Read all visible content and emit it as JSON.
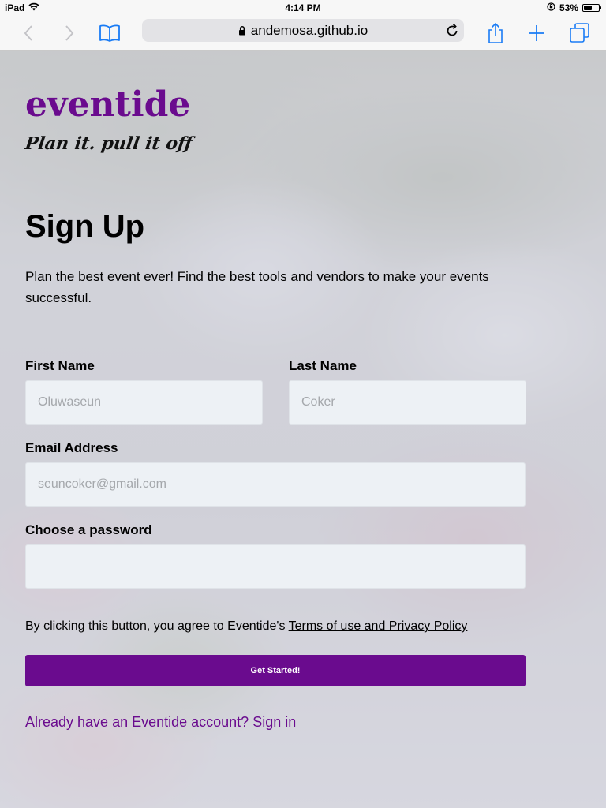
{
  "status_bar": {
    "device": "iPad",
    "time": "4:14 PM",
    "battery_percent": "53%",
    "battery_level": 0.53
  },
  "browser": {
    "url": "andemosa.github.io"
  },
  "brand": {
    "name": "eventide",
    "tagline": "Plan it. pull it off",
    "accent_color": "#6a0b8e"
  },
  "form": {
    "heading": "Sign Up",
    "intro": "Plan the best event ever! Find the best tools and vendors to make your events successful.",
    "first_name": {
      "label": "First Name",
      "placeholder": "Oluwaseun",
      "value": ""
    },
    "last_name": {
      "label": "Last Name",
      "placeholder": "Coker",
      "value": ""
    },
    "email": {
      "label": "Email Address",
      "placeholder": "seuncoker@gmail.com",
      "value": ""
    },
    "password": {
      "label": "Choose a password",
      "placeholder": "",
      "value": ""
    },
    "terms_prefix": "By clicking this button, you agree to Eventide's ",
    "terms_link": "Terms of use and Privacy Policy",
    "submit_label": "Get Started!",
    "signin_link": "Already have an Eventide account? Sign in"
  }
}
